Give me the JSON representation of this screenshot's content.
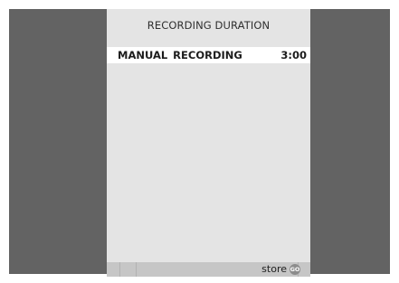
{
  "screen": {
    "title": "RECORDING  DURATION"
  },
  "menu": {
    "item_label": "MANUAL  RECORDING",
    "item_value": "3:00"
  },
  "footer": {
    "store_label": "store",
    "go_label": "GO"
  },
  "colors": {
    "frame": "#636363",
    "panel": "#e4e4e4",
    "highlight": "#ffffff",
    "footer_bar": "#c6c6c6",
    "go_button": "#8c8c8c"
  }
}
